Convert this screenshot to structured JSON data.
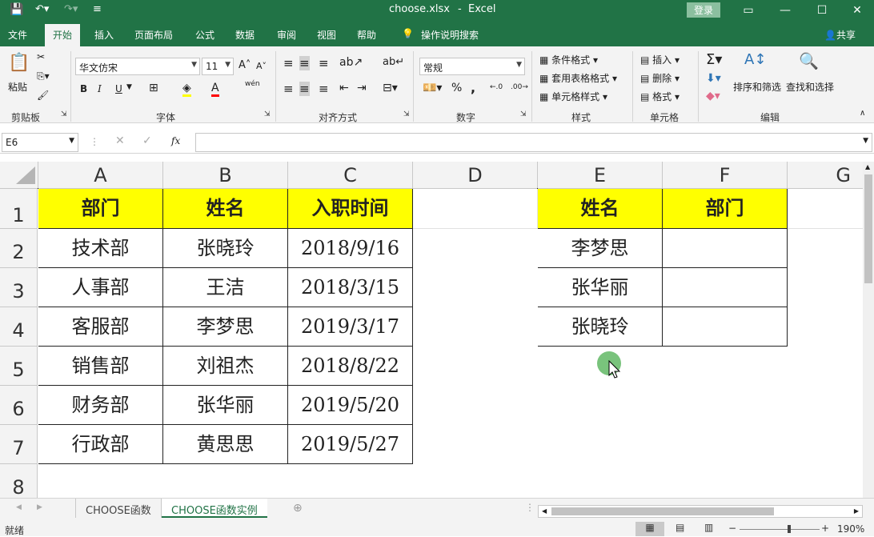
{
  "title": {
    "file": "choose.xlsx",
    "sep": "-",
    "app": "Excel",
    "login": "登录"
  },
  "menu": [
    "文件",
    "开始",
    "插入",
    "页面布局",
    "公式",
    "数据",
    "审阅",
    "视图",
    "帮助",
    "操作说明搜索"
  ],
  "share": "共享",
  "ribbon": {
    "paste": "粘贴",
    "clipboard": "剪贴板",
    "font_name": "华文仿宋",
    "font_size": "11",
    "font": "字体",
    "bold": "B",
    "italic": "I",
    "underline": "U",
    "fontcolor": "A",
    "wen": "wén",
    "align": "对齐方式",
    "num_format": "常规",
    "number": "数字",
    "percent": "%",
    "comma": ",",
    "cond": "条件格式",
    "table": "套用表格格式",
    "cellstyle": "单元格样式",
    "styles": "样式",
    "insert": "插入",
    "delete": "删除",
    "format": "格式",
    "cells": "单元格",
    "sortfilter": "排序和筛选",
    "findselect": "查找和选择",
    "editing": "编辑"
  },
  "namebox": "E6",
  "fx": "fx",
  "columns": [
    "A",
    "B",
    "C",
    "D",
    "E",
    "F",
    "G"
  ],
  "rows": [
    "1",
    "2",
    "3",
    "4",
    "5",
    "6",
    "7",
    "8"
  ],
  "table1": {
    "headers": [
      "部门",
      "姓名",
      "入职时间"
    ],
    "rows": [
      [
        "技术部",
        "张晓玲",
        "2018/9/16"
      ],
      [
        "人事部",
        "王洁",
        "2018/3/15"
      ],
      [
        "客服部",
        "李梦思",
        "2019/3/17"
      ],
      [
        "销售部",
        "刘祖杰",
        "2018/8/22"
      ],
      [
        "财务部",
        "张华丽",
        "2019/5/20"
      ],
      [
        "行政部",
        "黄思思",
        "2019/5/27"
      ]
    ]
  },
  "table2": {
    "headers": [
      "姓名",
      "部门"
    ],
    "rows": [
      [
        "李梦思",
        ""
      ],
      [
        "张华丽",
        ""
      ],
      [
        "张晓玲",
        ""
      ]
    ]
  },
  "sheets": [
    "CHOOSE函数",
    "CHOOSE函数实例"
  ],
  "status": {
    "ready": "就绪",
    "zoom": "190%"
  },
  "colors": {
    "excel_green": "#217346",
    "header_fill": "#ffff00"
  }
}
